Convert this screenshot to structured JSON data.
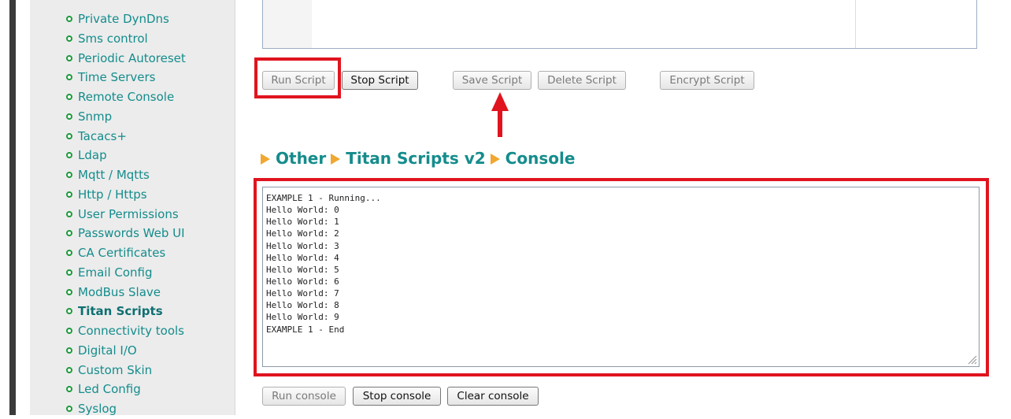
{
  "sidebar": {
    "items": [
      {
        "label": "Private DynDns"
      },
      {
        "label": "Sms control"
      },
      {
        "label": "Periodic Autoreset"
      },
      {
        "label": "Time Servers"
      },
      {
        "label": "Remote Console"
      },
      {
        "label": "Snmp"
      },
      {
        "label": "Tacacs+"
      },
      {
        "label": "Ldap"
      },
      {
        "label": "Mqtt / Mqtts"
      },
      {
        "label": "Http / Https"
      },
      {
        "label": "User Permissions"
      },
      {
        "label": "Passwords Web UI"
      },
      {
        "label": "CA Certificates"
      },
      {
        "label": "Email Config"
      },
      {
        "label": "ModBus Slave"
      },
      {
        "label": "Titan Scripts",
        "active": true
      },
      {
        "label": "Connectivity tools"
      },
      {
        "label": "Digital I/O"
      },
      {
        "label": "Custom Skin"
      },
      {
        "label": "Led Config"
      },
      {
        "label": "Syslog"
      }
    ]
  },
  "script_toolbar": {
    "run": "Run Script",
    "stop": "Stop Script",
    "save": "Save Script",
    "delete": "Delete Script",
    "encrypt": "Encrypt Script"
  },
  "breadcrumb": {
    "items": [
      "Other",
      "Titan Scripts v2",
      "Console"
    ]
  },
  "console": {
    "lines": [
      "EXAMPLE 1 - Running...",
      "Hello World: 0",
      "Hello World: 1",
      "Hello World: 2",
      "Hello World: 3",
      "Hello World: 4",
      "Hello World: 5",
      "Hello World: 6",
      "Hello World: 7",
      "Hello World: 8",
      "Hello World: 9",
      "EXAMPLE 1 - End"
    ]
  },
  "console_toolbar": {
    "run": "Run console",
    "stop": "Stop console",
    "clear": "Clear console"
  },
  "icons": {
    "bullet": "circle-bullet-icon",
    "breadcrumb_separator": "triangle-right-icon",
    "annotation_arrow": "arrow-up-icon",
    "resize": "resize-grip-icon"
  },
  "colors": {
    "link": "#158c8c",
    "bullet": "#1c9a3b",
    "separator": "#f0a830",
    "annotation": "#e0141e"
  }
}
